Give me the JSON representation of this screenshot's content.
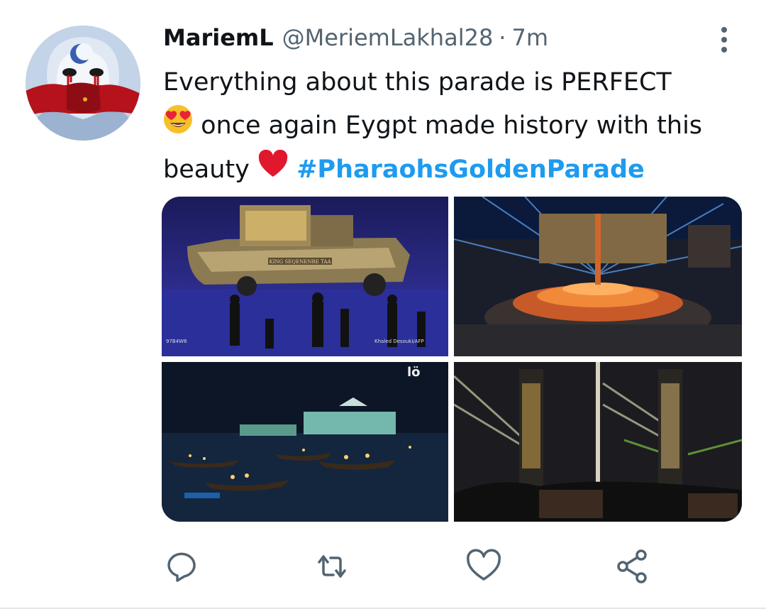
{
  "tweet": {
    "display_name": "MariemL",
    "handle": "@MeriemLakhal28",
    "separator": "·",
    "time": "7m",
    "text_part1": "Everything about this parade is PERFECT",
    "text_part2": " once again Eygpt made history with this beauty ",
    "hashtag": "#PharaohsGoldenParade"
  },
  "media": {
    "image1": {
      "boat_label": "KING SEQENENRE TAA",
      "credit": "Khaled Desouki/AFP",
      "corner_code": "97B4W6"
    },
    "image3": {
      "logo_text": "lö"
    }
  },
  "icons": {
    "more": "more-vertical-icon",
    "reply": "reply-icon",
    "retweet": "retweet-icon",
    "like": "heart-icon",
    "share": "share-icon",
    "emoji1": "heart-eyes-emoji",
    "emoji2": "red-heart-emoji"
  },
  "colors": {
    "hashtag": "#1d9bf0",
    "icon": "#536471",
    "text": "#0f1419"
  }
}
